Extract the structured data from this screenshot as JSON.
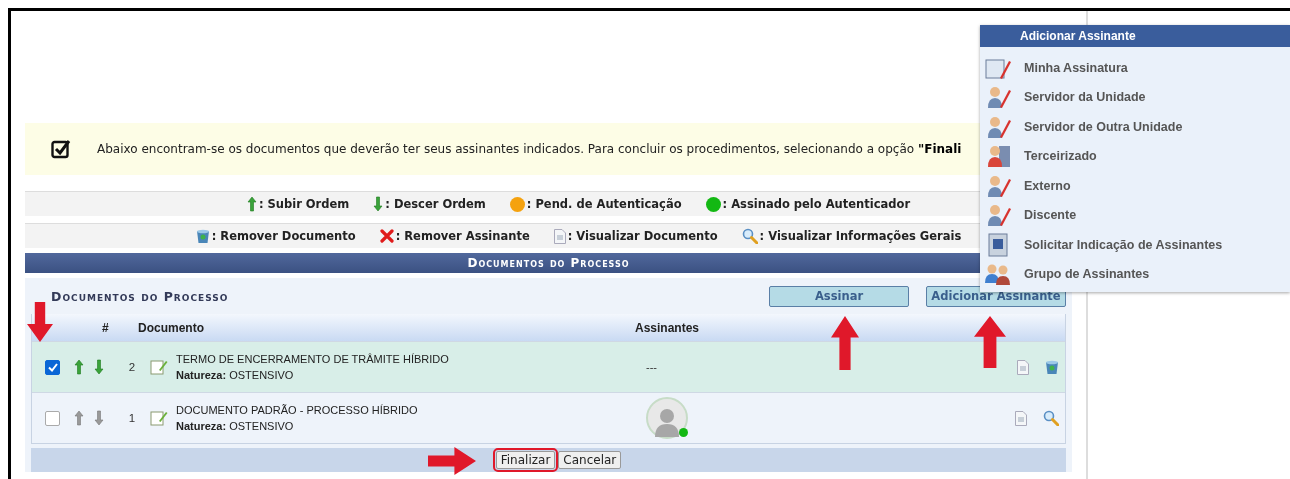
{
  "notice": {
    "text": "Abaixo encontram-se os documentos que deverão ter seus assinantes indicados. Para concluir os procedimentos, selecionando a opção **\"Finali**"
  },
  "legend": [
    [
      {
        "kind": "up",
        "label": ": Subir Ordem"
      },
      {
        "kind": "down",
        "label": ": Descer Ordem"
      },
      {
        "kind": "dot",
        "color": "#f5a20f",
        "label": ": Pend. de Autenticação"
      },
      {
        "kind": "dot",
        "color": "#13b813",
        "label": ": Assinado pelo Autenticador"
      }
    ],
    [
      {
        "kind": "trash",
        "label": ": Remover Documento"
      },
      {
        "kind": "cross",
        "label": ": Remover Assinante"
      },
      {
        "kind": "doc",
        "label": ": Visualizar Documento"
      },
      {
        "kind": "search",
        "label": ": Visualizar Informações Gerais"
      }
    ]
  ],
  "section_header": "Documentos do Processo",
  "panel": {
    "title": "Documentos do Processo",
    "buttons": [
      "Assinar",
      "Adicionar Assinante"
    ],
    "columns": [
      "#",
      "Documento",
      "Assinantes"
    ],
    "rows": [
      {
        "checked": true,
        "selected": true,
        "movable": true,
        "number": "2",
        "title": "TERMO DE ENCERRAMENTO DE TRÂMITE HÍBRIDO",
        "nature_label": "Natureza:",
        "nature": "OSTENSIVO",
        "signers_text": "---",
        "actions": [
          {
            "kind": "doc"
          },
          {
            "kind": "trash"
          }
        ]
      },
      {
        "checked": false,
        "selected": false,
        "movable": false,
        "number": "1",
        "title": "DOCUMENTO PADRÃO - PROCESSO HÍBRIDO",
        "nature_label": "Natureza:",
        "nature": "OSTENSIVO",
        "signer_avatar": {
          "color": "#13b813"
        },
        "actions": [
          {
            "kind": "doc"
          },
          {
            "kind": "search"
          }
        ]
      }
    ]
  },
  "footer_buttons": [
    {
      "label": "Finalizar",
      "annotated": true
    },
    {
      "label": "Cancelar",
      "annotated": false
    }
  ],
  "menu": {
    "title": "Adicionar Assinante",
    "items": [
      {
        "kind": "signature",
        "label": "Minha Assinatura"
      },
      {
        "kind": "person",
        "label": "Servidor da Unidade"
      },
      {
        "kind": "person",
        "label": "Servidor de Outra Unidade"
      },
      {
        "kind": "building-person",
        "label": "Terceirizado"
      },
      {
        "kind": "person",
        "label": "Externo"
      },
      {
        "kind": "person",
        "label": "Discente"
      },
      {
        "kind": "building",
        "label": "Solicitar Indicação de Assinantes"
      },
      {
        "kind": "group",
        "label": "Grupo de Assinantes"
      }
    ]
  }
}
